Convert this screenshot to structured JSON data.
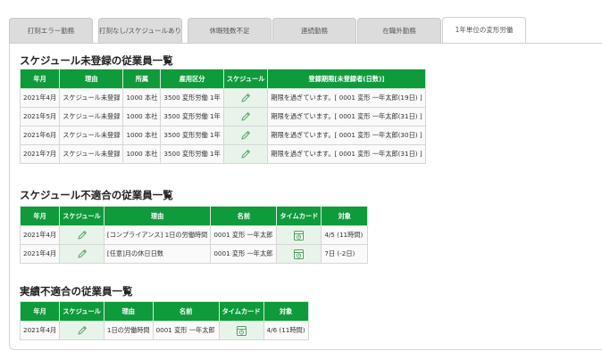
{
  "tabs": [
    {
      "label": "打刻エラー勤務",
      "active": false
    },
    {
      "label": "打刻なし/スケジュールあり",
      "active": false
    },
    {
      "label": "休暇残数不足",
      "active": false
    },
    {
      "label": "連続勤務",
      "active": false
    },
    {
      "label": "在職外勤務",
      "active": false
    },
    {
      "label": "1年単位の変形労働",
      "active": true
    }
  ],
  "sections": {
    "unregistered": {
      "title": "スケジュール未登録の従業員一覧",
      "headers": [
        "年月",
        "理由",
        "所属",
        "雇用区分",
        "スケジュール",
        "登録期限[未登録者(日数)]"
      ],
      "rows": [
        {
          "month": "2021年4月",
          "reason": "スケジュール未登録",
          "dept": "1000 本社",
          "type": "3500 変形労働 1年",
          "deadline": "期限を過ぎています。[ 0001 変形 一年太郎(19日) ]"
        },
        {
          "month": "2021年5月",
          "reason": "スケジュール未登録",
          "dept": "1000 本社",
          "type": "3500 変形労働 1年",
          "deadline": "期限を過ぎています。[ 0001 変形 一年太郎(31日) ]"
        },
        {
          "month": "2021年6月",
          "reason": "スケジュール未登録",
          "dept": "1000 本社",
          "type": "3500 変形労働 1年",
          "deadline": "期限を過ぎています。[ 0001 変形 一年太郎(30日) ]"
        },
        {
          "month": "2021年7月",
          "reason": "スケジュール未登録",
          "dept": "1000 本社",
          "type": "3500 変形労働 1年",
          "deadline": "期限を過ぎています。[ 0001 変形 一年太郎(31日) ]"
        }
      ]
    },
    "mismatch": {
      "title": "スケジュール不適合の従業員一覧",
      "headers": [
        "年月",
        "スケジュール",
        "理由",
        "名前",
        "タイムカード",
        "対象"
      ],
      "rows": [
        {
          "month": "2021年4月",
          "reason": "[コンプライアンス] 1日の労働時間",
          "name": "0001 変形 一年太郎",
          "target": "4/5 (11時間)"
        },
        {
          "month": "2021年4月",
          "reason": "[任意]月の休日日数",
          "name": "0001 変形 一年太郎",
          "target": "7日 (-2日)"
        }
      ]
    },
    "actual": {
      "title": "実績不適合の従業員一覧",
      "headers": [
        "年月",
        "スケジュール",
        "理由",
        "名前",
        "タイムカード",
        "対象"
      ],
      "rows": [
        {
          "month": "2021年4月",
          "reason": "1日の労働時間",
          "name": "0001 変形 一年太郎",
          "target": "4/6 (11時間)"
        }
      ]
    }
  },
  "icons": {
    "pencil": "pencil-icon",
    "timecard": "timecard-icon"
  },
  "colors": {
    "header_green": "#0f9a3b",
    "icon_cell_bg": "#e8f4ea"
  }
}
